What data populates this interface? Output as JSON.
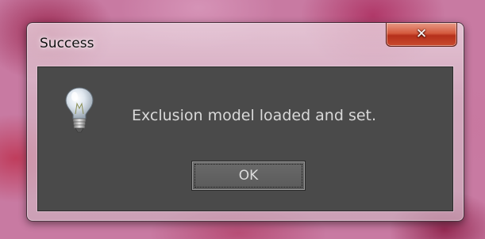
{
  "dialog": {
    "title": "Success",
    "close_glyph": "✕",
    "message": "Exclusion model loaded and set.",
    "ok_label": "OK",
    "icon": "lightbulb-icon"
  },
  "colors": {
    "content_background": "#4a4a4a",
    "message_text": "#d9d9d9",
    "close_button": "#c94a2e"
  }
}
